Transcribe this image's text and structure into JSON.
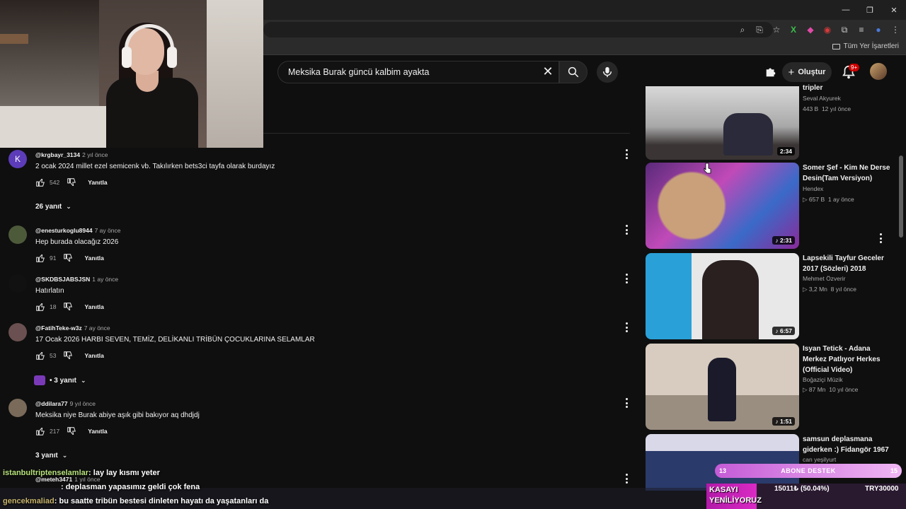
{
  "browser": {
    "bookmarks_all_label": "Tüm Yer İşaretleri"
  },
  "header": {
    "search_value": "Meksika Burak güncü kalbim ayakta",
    "create_label": "Oluştur",
    "notification_count": "9+"
  },
  "comments": [
    {
      "avatar_letter": "K",
      "avatar_color": "#5c3cb8",
      "user": "@krgbayr_3134",
      "time": "2 yıl önce",
      "text": "2 ocak 2024 millet ezel semicenk vb. Takılırken bets3ci tayfa olarak burdayız",
      "likes": "542",
      "reply_label": "Yanıtla",
      "replies": "26 yanıt"
    },
    {
      "avatar_letter": "",
      "avatar_color": "#4d5a3a",
      "user": "@enesturkoglu8944",
      "time": "7 ay önce",
      "text": "Hep burada olacağız 2026",
      "likes": "91",
      "reply_label": "Yanıtla"
    },
    {
      "avatar_letter": "",
      "avatar_color": "#111111",
      "user": "@SKDBSJABSJSN",
      "time": "1 ay önce",
      "text": "Hatırlatın",
      "likes": "18",
      "reply_label": "Yanıtla"
    },
    {
      "avatar_letter": "",
      "avatar_color": "#6a5050",
      "user": "@FatihTeke-w3z",
      "time": "7 ay önce",
      "text": "17 Ocak 2026 HARBI SEVEN, TEMİZ, DELİKANLI  TRİBÜN ÇOCUKLARINA SELAMLAR",
      "likes": "53",
      "reply_label": "Yanıtla",
      "replies": "• 3 yanıt"
    },
    {
      "avatar_letter": "",
      "avatar_color": "#7a6a5a",
      "user": "@ddilara77",
      "time": "9 yıl önce",
      "text": "Meksika niye Burak abiye aşık gibi bakıyor aq dhdjdj",
      "likes": "217",
      "reply_label": "Yanıtla",
      "replies": "3 yanıt"
    },
    {
      "avatar_letter": "",
      "avatar_color": "#884444",
      "user": "@meteh3471",
      "time": "1 yıl önce",
      "text": "",
      "likes": "",
      "reply_label": ""
    }
  ],
  "sidebar": {
    "videos": [
      {
        "title": "tripler",
        "channel": "Seval Akyurek",
        "views": "443 B",
        "age": "12 yıl önce",
        "duration": "2:34",
        "thumb_color": "#c9c9c9"
      },
      {
        "title": "Somer Şef - Kim Ne Derse Desin(Tam Versiyon)",
        "channel": "Hendex",
        "views": "657 B",
        "age": "1 ay önce",
        "duration": "2:31",
        "thumb_color": "#7a3a8a"
      },
      {
        "title": "Lapsekili Tayfur Geceler 2017 (Sözleri) 2018",
        "channel": "Mehmet Özverir",
        "views": "3,2 Mn",
        "age": "8 yıl önce",
        "duration": "6:57",
        "thumb_color": "#3a6aa0"
      },
      {
        "title": "Isyan Tetick - Adana Merkez Patlıyor Herkes (Official Video)",
        "channel": "Boğaziçi Müzik",
        "views": "87 Mn",
        "age": "10 yıl önce",
        "duration": "1:51",
        "thumb_color": "#b8a898"
      },
      {
        "title": "samsun deplasmana giderken :) Fidangör 1967",
        "channel": "can yeşilyurt",
        "views": "",
        "age": "",
        "duration": "",
        "thumb_color": "#2a3a6a"
      }
    ]
  },
  "stream": {
    "chat": [
      {
        "user": "istanbultriptenselamlar",
        "message": ": lay lay kısmı yeter"
      },
      {
        "user": "",
        "message": ": deplasman yapasımız geldi çok fena"
      },
      {
        "user": "gencekmaliad",
        "message": ": bu saatte tribün bestesi dinleten hayatı da yaşatanları da"
      }
    ],
    "abone": {
      "left": "13",
      "label": "ABONE DESTEK",
      "right": "15",
      "progress_fraction": 0.87
    },
    "donate": {
      "label_line1": "KASAYI",
      "label_line2": "YENİLİYORUZ",
      "amount": "15011₺ (50.04%)",
      "goal": "TRY30000",
      "progress_fraction": 0.5004
    }
  }
}
